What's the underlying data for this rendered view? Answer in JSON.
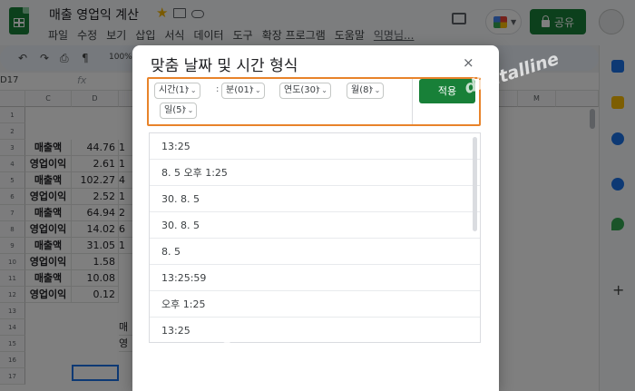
{
  "doc": {
    "title": "매출 영업익 계산",
    "menus": [
      "파일",
      "수정",
      "보기",
      "삽입",
      "서식",
      "데이터",
      "도구",
      "확장 프로그램",
      "도움말",
      "익명님..."
    ]
  },
  "header": {
    "share_label": "공유"
  },
  "toolbar": {
    "zoom": "100%"
  },
  "formula_bar": {
    "cell_ref": "D17",
    "fx": "fx"
  },
  "grid": {
    "columns": [
      "C",
      "D",
      "M"
    ],
    "row_numbers": [
      "1",
      "2",
      "3",
      "4",
      "5",
      "6",
      "7",
      "8",
      "9",
      "10",
      "11",
      "12",
      "13",
      "14",
      "15",
      "16",
      "17"
    ],
    "rows": [
      {
        "label": "매출액",
        "value": "44.76",
        "extra": "1"
      },
      {
        "label": "영업이익",
        "value": "2.61",
        "extra": "1"
      },
      {
        "label": "매출액",
        "value": "102.27",
        "extra": "4"
      },
      {
        "label": "영업이익",
        "value": "2.52",
        "extra": "1"
      },
      {
        "label": "매출액",
        "value": "64.94",
        "extra": "2"
      },
      {
        "label": "영업이익",
        "value": "14.02",
        "extra": "6"
      },
      {
        "label": "매출액",
        "value": "31.05",
        "extra": "1"
      },
      {
        "label": "영업이익",
        "value": "1.58",
        "extra": ""
      },
      {
        "label": "매출액",
        "value": "10.08",
        "extra": ""
      },
      {
        "label": "영업이익",
        "value": "0.12",
        "extra": ""
      }
    ],
    "partial_e14": "매",
    "partial_e15": "영"
  },
  "dialog": {
    "title": "맞춤 날짜 및 시간 형식",
    "close": "×",
    "chips": [
      "시간(1)",
      "분(01)",
      "연도(30)",
      "월(8)",
      "일(5)"
    ],
    "separator": ":",
    "apply_label": "적용",
    "formats": [
      "13:25",
      "8. 5 오후 1:25",
      "30. 8. 5",
      "30. 8. 5",
      "8. 5",
      "13:25:59",
      "오후 1:25",
      "13:25"
    ]
  },
  "watermarks": [
    "digitalline",
    "digitalline"
  ],
  "colors": {
    "brand_green": "#188038",
    "highlight_orange": "#e8832a",
    "selection_blue": "#1a73e8"
  }
}
